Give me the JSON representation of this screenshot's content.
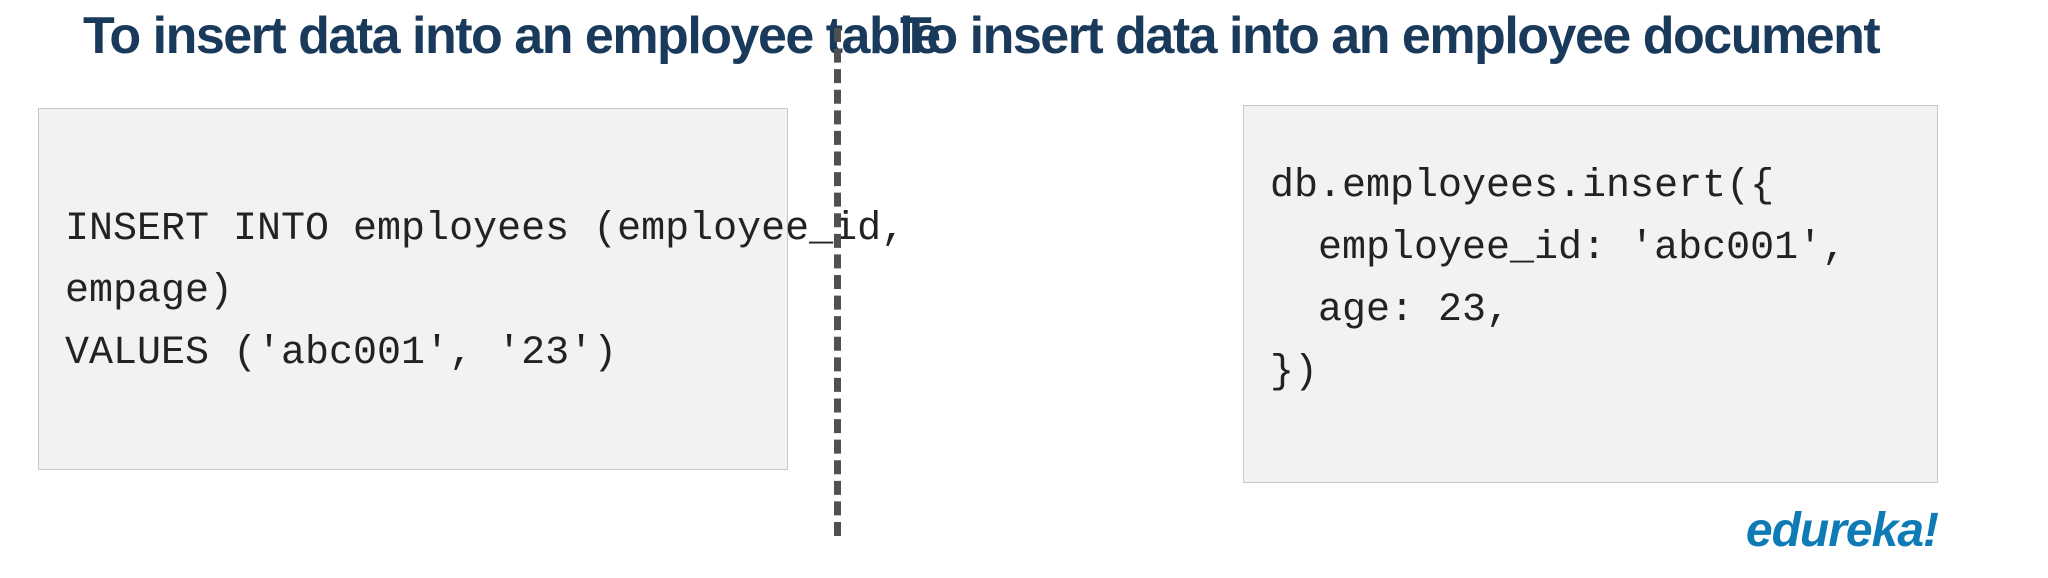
{
  "left": {
    "heading": "To insert data into an employee table",
    "code": "INSERT INTO employees (employee_id,\nempage)\nVALUES ('abc001', '23')"
  },
  "right": {
    "heading": "To insert data into an employee document",
    "code": "db.employees.insert({\n  employee_id: 'abc001',\n  age: 23,\n})"
  },
  "brand": "edureka!"
}
